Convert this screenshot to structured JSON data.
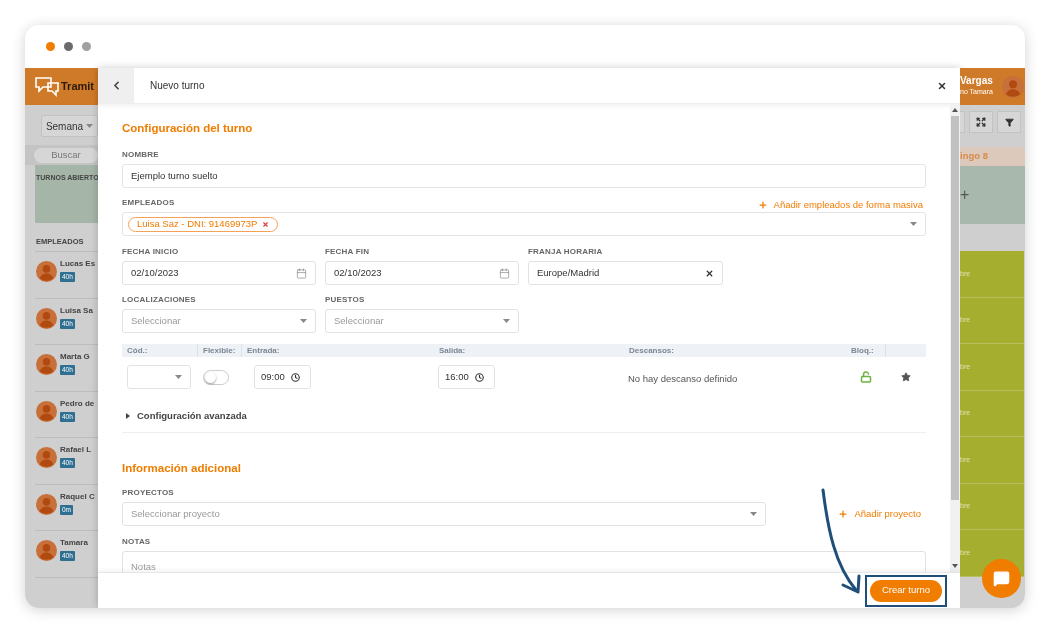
{
  "window_dots": [
    {
      "color": "#f07c00"
    },
    {
      "color": "#6b6b6b"
    },
    {
      "color": "#a0a0a0"
    }
  ],
  "background_app": {
    "logo": "Tramit",
    "view_button": "Semana",
    "search_placeholder": "Buscar",
    "open_shifts_label": "TURNOS ABIERTO",
    "employees_label": "EMPLEADOS",
    "employees": [
      {
        "name": "Lucas Es",
        "hours": "40h"
      },
      {
        "name": "Luisa Sa",
        "hours": "40h"
      },
      {
        "name": "Marta G",
        "hours": "40h"
      },
      {
        "name": "Pedro de",
        "hours": "40h"
      },
      {
        "name": "Rafael L",
        "hours": "40h"
      },
      {
        "name": "Raquel C",
        "hours": "0m"
      },
      {
        "name": "Tamara",
        "hours": "40h"
      }
    ],
    "user_name": "Vargas",
    "user_subtitle": "no Tamara",
    "day_header": "ingo 8",
    "add_sign": "+",
    "day_cells": [
      "bre",
      "bre",
      "bre",
      "bre",
      "bre",
      "bre",
      "bre"
    ]
  },
  "modal": {
    "title": "Nuevo turno",
    "section_1_title": "Configuración del turno",
    "name_label": "NOMBRE",
    "name_value": "Ejemplo turno suelto",
    "employees_label": "EMPLEADOS",
    "bulk_add_link": "Añadir empleados de forma masiva",
    "employee_chips": [
      "Luisa Saz - DNI: 91469973P"
    ],
    "start_date_label": "FECHA INICIO",
    "start_date": "02/10/2023",
    "end_date_label": "FECHA FIN",
    "end_date": "02/10/2023",
    "timezone_label": "FRANJA HORARIA",
    "timezone": "Europe/Madrid",
    "locations_label": "LOCALIZACIONES",
    "locations_placeholder": "Seleccionar",
    "positions_label": "PUESTOS",
    "positions_placeholder": "Seleccionar",
    "shift_table": {
      "columns": [
        "Cód.:",
        "Flexible:",
        "Entrada:",
        "Salida:",
        "Descansos:",
        "Bloq.:"
      ],
      "row": {
        "flexible": false,
        "entry": "09:00",
        "exit": "16:00",
        "breaks": "No hay descanso definido",
        "locked": false
      }
    },
    "advanced": {
      "label": "Configuración avanzada",
      "expanded": false
    },
    "section_2_title": "Información adicional",
    "projects_label": "PROYECTOS",
    "projects_placeholder": "Seleccionar proyecto",
    "add_project_link": "Añadir proyecto",
    "notes_label": "NOTAS",
    "notes_placeholder": "Notas",
    "create_button": "Crear turno"
  }
}
